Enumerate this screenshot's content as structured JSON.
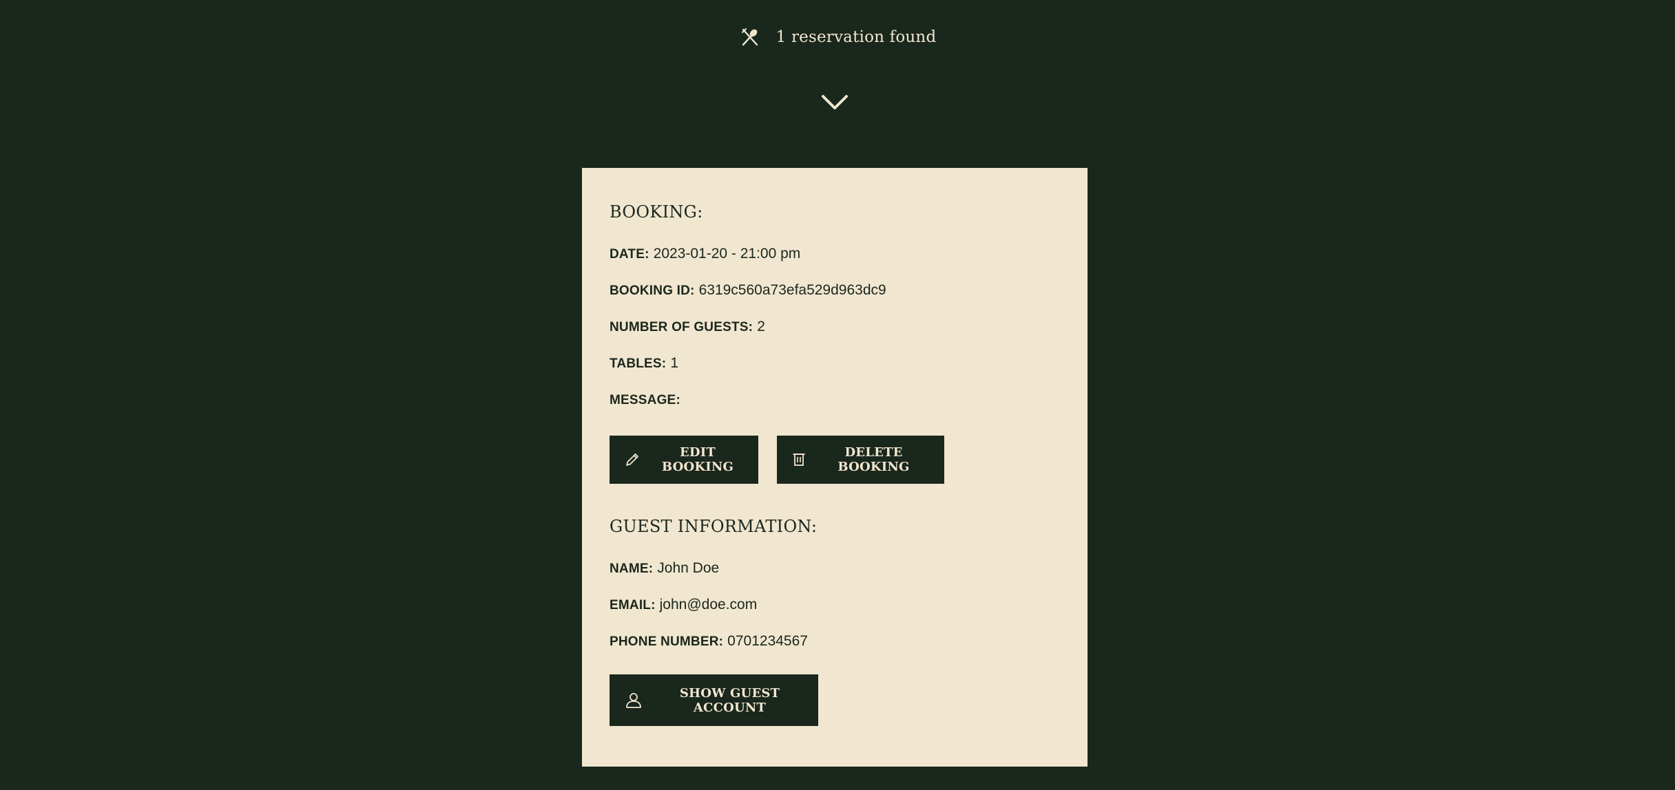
{
  "header": {
    "reservation_count_text": "1 reservation found"
  },
  "icons": {
    "header": "utensils-icon",
    "toggle": "chevron-down-icon",
    "edit": "pencil-icon",
    "delete": "trash-icon",
    "guest": "user-icon"
  },
  "colors": {
    "background": "#1a271d",
    "card": "#f1e6cf",
    "text_light": "#f0e6d0"
  },
  "booking": {
    "title": "BOOKING:",
    "date_label": "DATE:",
    "date_value": "2023-01-20 - 21:00 pm",
    "id_label": "BOOKING ID:",
    "id_value": "6319c560a73efa529d963dc9",
    "guests_label": "NUMBER OF GUESTS:",
    "guests_value": "2",
    "tables_label": "TABLES:",
    "tables_value": "1",
    "message_label": "MESSAGE:",
    "message_value": "",
    "edit_button": "EDIT BOOKING",
    "delete_button": "DELETE BOOKING"
  },
  "guest": {
    "title": "GUEST INFORMATION:",
    "name_label": "NAME:",
    "name_value": "John Doe",
    "email_label": "EMAIL:",
    "email_value": "john@doe.com",
    "phone_label": "PHONE NUMBER:",
    "phone_value": "0701234567",
    "show_account_button": "SHOW GUEST ACCOUNT"
  }
}
